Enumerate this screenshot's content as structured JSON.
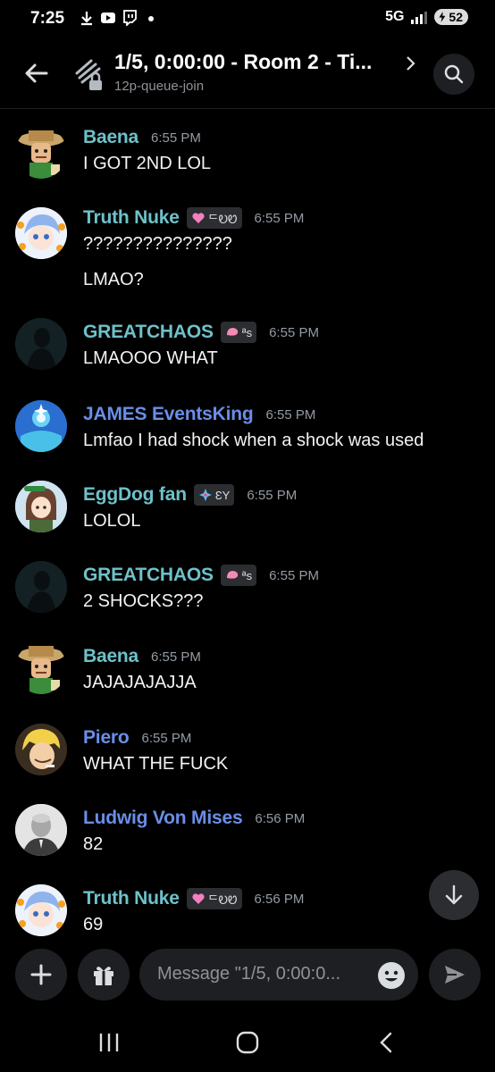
{
  "status_bar": {
    "time": "7:25",
    "network": "5G",
    "battery": "52"
  },
  "header": {
    "title": "1/5, 0:00:00 - Room 2 - Ti...",
    "subtitle": "12p-queue-join"
  },
  "messages": [
    {
      "user": "Baena",
      "name_color": "teal",
      "tag": null,
      "time": "6:55 PM",
      "lines": [
        "I GOT 2ND LOL"
      ],
      "avatar": "mii-hat-avatar"
    },
    {
      "user": "Truth Nuke",
      "name_color": "teal",
      "tag": "ᄃᎧᏬ",
      "tag_icon": "pink-heart-icon",
      "time": "6:55 PM",
      "lines": [
        "???????????????",
        "LMAO?"
      ],
      "avatar": "anime-dragonball-avatar"
    },
    {
      "user": "GREATCHAOS",
      "name_color": "teal",
      "tag": "ªs",
      "tag_icon": "pink-shell-icon",
      "time": "6:55 PM",
      "lines": [
        "LMAOOO WHAT"
      ],
      "avatar": "dark-silhouette-avatar"
    },
    {
      "user": "JAMES EventsKing",
      "name_color": "blue",
      "tag": null,
      "time": "6:55 PM",
      "lines": [
        "Lmfao I had shock when a shock was used"
      ],
      "avatar": "blue-sparkle-avatar"
    },
    {
      "user": "EggDog fan",
      "name_color": "teal",
      "tag": "ƐY",
      "tag_icon": "compass-icon",
      "time": "6:55 PM",
      "lines": [
        "LOLOL"
      ],
      "avatar": "anime-girl-avatar"
    },
    {
      "user": "GREATCHAOS",
      "name_color": "teal",
      "tag": "ªs",
      "tag_icon": "pink-shell-icon",
      "time": "6:55 PM",
      "lines": [
        "2 SHOCKS???"
      ],
      "avatar": "dark-silhouette-avatar"
    },
    {
      "user": "Baena",
      "name_color": "teal",
      "tag": null,
      "time": "6:55 PM",
      "lines": [
        "JAJAJAJAJJA"
      ],
      "avatar": "mii-hat-avatar"
    },
    {
      "user": "Piero",
      "name_color": "blue",
      "tag": null,
      "time": "6:55 PM",
      "lines": [
        "WHAT THE FUCK"
      ],
      "avatar": "anime-blonde-avatar"
    },
    {
      "user": "Ludwig Von Mises",
      "name_color": "blue",
      "tag": null,
      "time": "6:56 PM",
      "lines": [
        "82"
      ],
      "avatar": "old-man-photo-avatar"
    },
    {
      "user": "Truth Nuke",
      "name_color": "teal",
      "tag": "ᄃᎧᏬ",
      "tag_icon": "pink-heart-icon",
      "time": "6:56 PM",
      "lines": [
        "69"
      ],
      "avatar": "anime-dragonball-avatar"
    }
  ],
  "composer": {
    "placeholder": "Message \"1/5, 0:00:0..."
  },
  "colors": {
    "background": "#000000",
    "teal_name": "#6ec1c9",
    "blue_name": "#6a8ee8",
    "input_bg": "#1e1f22",
    "timestamp": "#949ba4"
  }
}
